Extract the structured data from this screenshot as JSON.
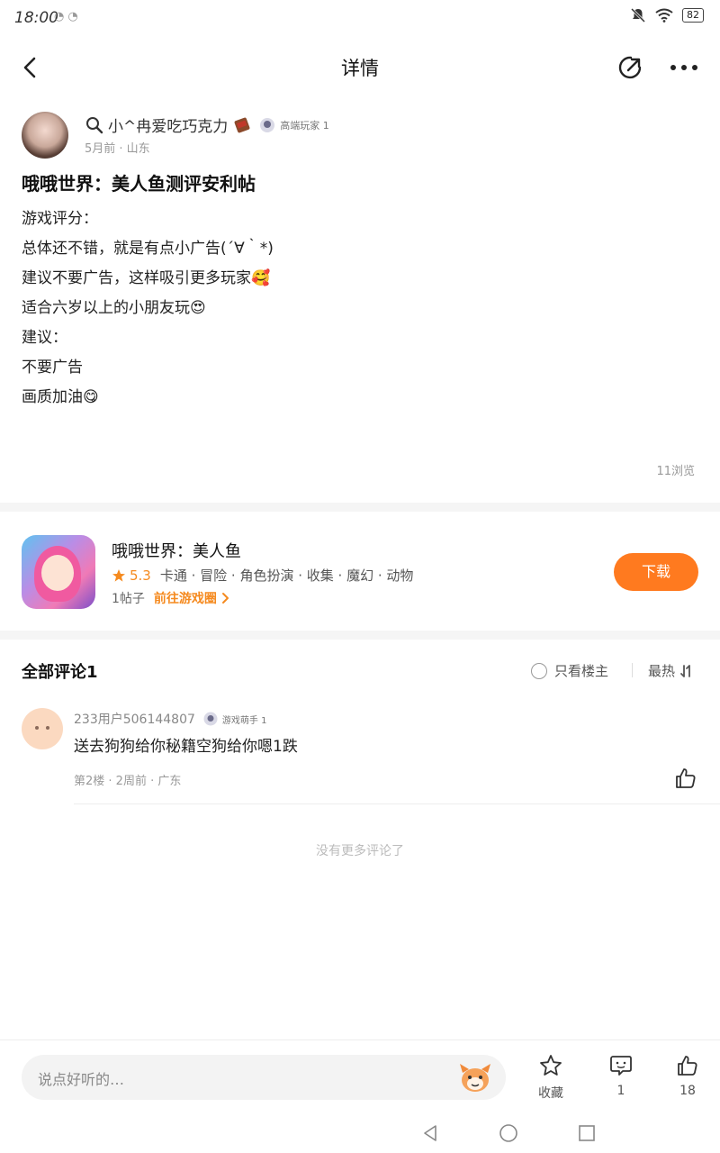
{
  "status_bar": {
    "time": "18:00",
    "battery": "82"
  },
  "nav": {
    "title": "详情"
  },
  "post": {
    "author": "小^冉爱吃巧克力",
    "author_badge": "高端玩家 1",
    "meta": "5月前 · 山东",
    "title": "哦哦世界：美人鱼测评安利帖",
    "lines": [
      "游戏评分：",
      "总体还不错，就是有点小广告(´∀｀*)",
      "建议不要广告，这样吸引更多玩家🥰",
      "适合六岁以上的小朋友玩😍",
      "建议：",
      "不要广告",
      "画质加油😋"
    ],
    "views": "11浏览"
  },
  "game": {
    "name": "哦哦世界：美人鱼",
    "rating": "5.3",
    "tags": "卡通 · 冒险 · 角色扮演 · 收集 · 魔幻 · 动物",
    "posts": "1帖子",
    "goto": "前往游戏圈",
    "download": "下载"
  },
  "comments": {
    "title": "全部评论1",
    "only_op": "只看楼主",
    "sort": "最热",
    "items": [
      {
        "user": "233用户506144807",
        "badge": "游戏萌手 1",
        "text": "送去狗狗给你秘籍空狗给你嗯1跌",
        "meta": "第2楼 · 2周前 · 广东"
      }
    ],
    "no_more": "没有更多评论了"
  },
  "bottom": {
    "placeholder": "说点好听的…",
    "favorite": "收藏",
    "comment_count": "1",
    "like_count": "18"
  }
}
